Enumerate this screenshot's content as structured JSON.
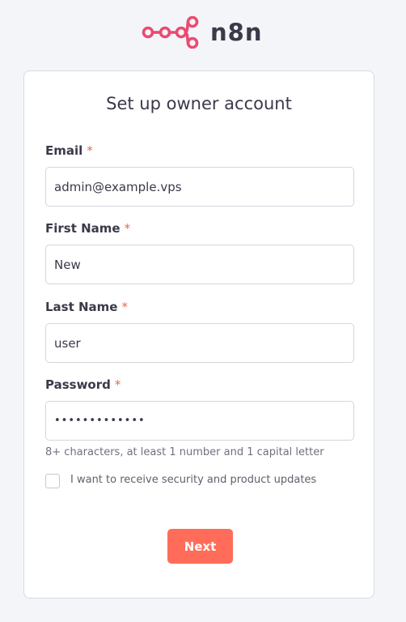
{
  "brand": {
    "name": "n8n",
    "accent_color": "#ea4b71"
  },
  "card": {
    "title": "Set up owner account"
  },
  "form": {
    "email": {
      "label": "Email",
      "required_mark": "*",
      "value": "admin@example.vps"
    },
    "first_name": {
      "label": "First Name",
      "required_mark": "*",
      "value": "New"
    },
    "last_name": {
      "label": "Last Name",
      "required_mark": "*",
      "value": "user"
    },
    "password": {
      "label": "Password",
      "required_mark": "*",
      "value": "•••••••••••••"
    },
    "password_hint": "8+ characters, at least 1 number and 1 capital letter",
    "updates_checkbox": {
      "label": "I want to receive security and product updates",
      "checked": false
    },
    "next_button": {
      "label": "Next",
      "color": "#ff6d5a"
    }
  }
}
